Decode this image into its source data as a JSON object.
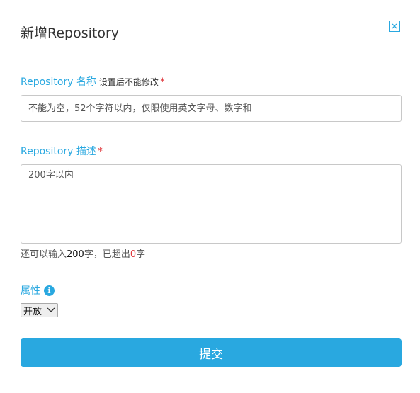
{
  "dialog": {
    "title": "新增Repository"
  },
  "name_field": {
    "label": "Repository 名称",
    "hint": "设置后不能修改",
    "required_mark": "*",
    "placeholder": "不能为空，52个字符以内，仅限使用英文字母、数字和_"
  },
  "desc_field": {
    "label": "Repository 描述",
    "required_mark": "*",
    "placeholder": "200字以内"
  },
  "counter": {
    "prefix": "还可以输入",
    "remaining": "200",
    "middle": "字，已超出",
    "exceeded": "0",
    "suffix": "字"
  },
  "attribute": {
    "label": "属性",
    "info_glyph": "i",
    "selected": "开放"
  },
  "submit": {
    "label": "提交"
  },
  "colors": {
    "accent": "#29a8e0",
    "required": "#e0393e"
  }
}
